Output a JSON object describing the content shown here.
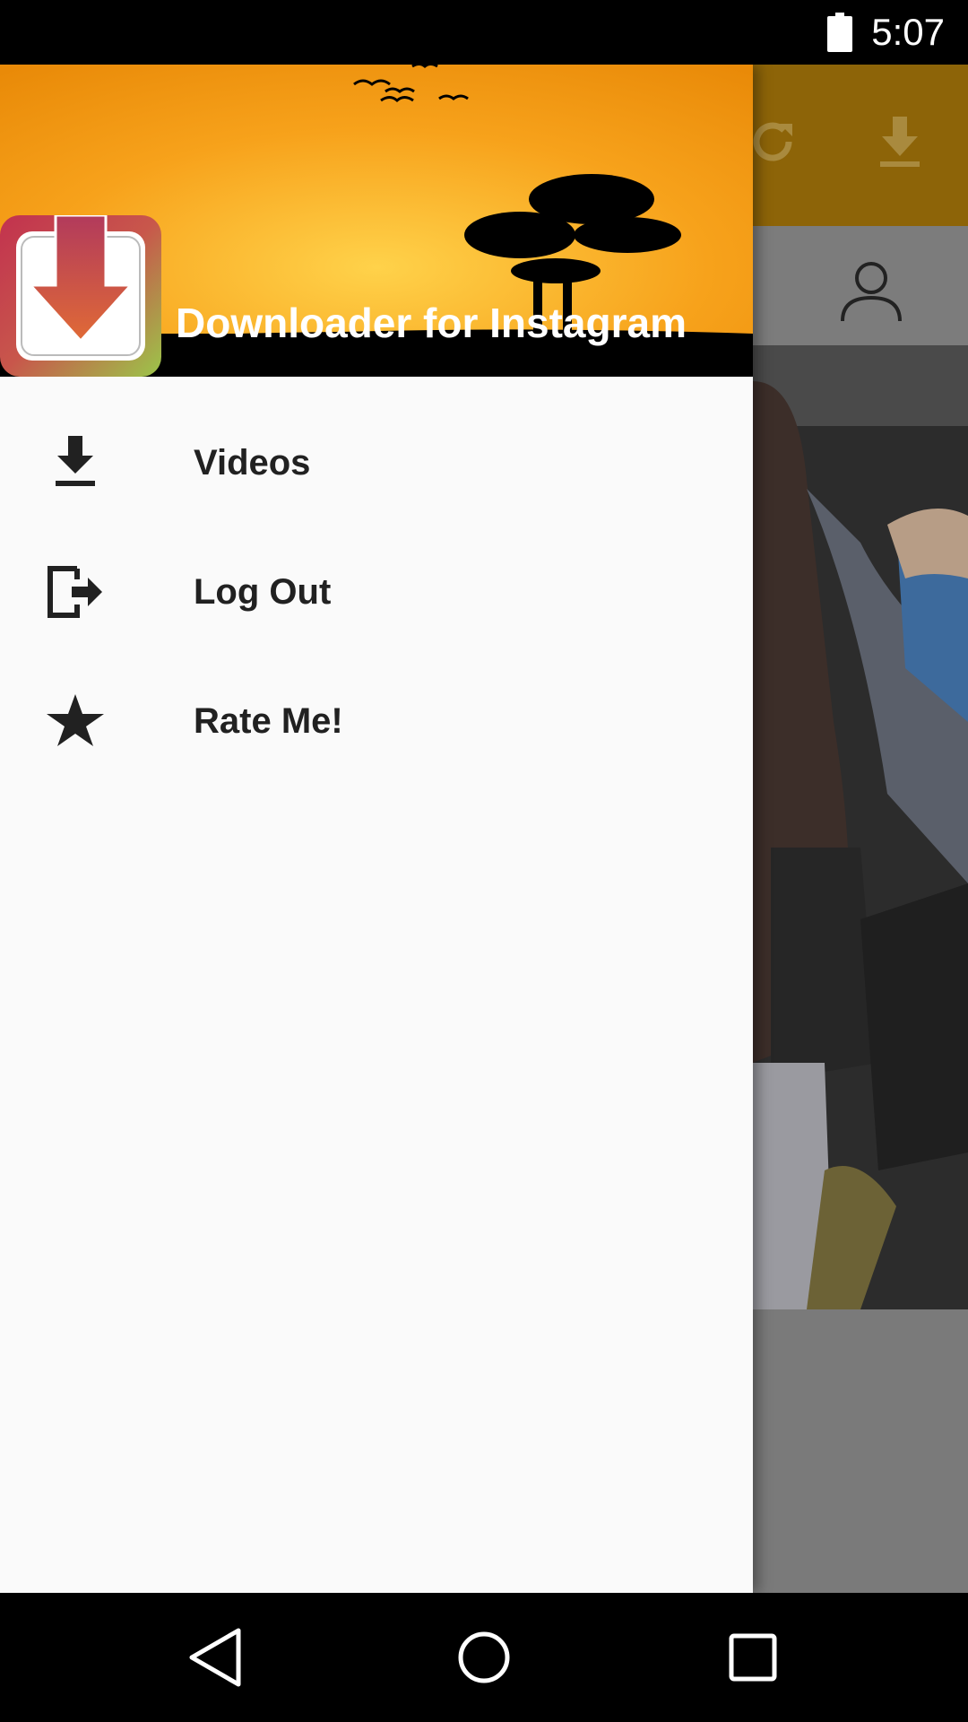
{
  "status_bar": {
    "time": "5:07"
  },
  "drawer": {
    "app_name": "Downloader for Instagram",
    "items": [
      {
        "label": "Videos",
        "icon": "download-icon"
      },
      {
        "label": "Log Out",
        "icon": "logout-icon"
      },
      {
        "label": "Rate Me!",
        "icon": "star-icon"
      }
    ]
  },
  "colors": {
    "toolbar": "#8d6408",
    "drawer_bg": "#fafafa",
    "header_sky": "#f29a12",
    "text": "#212121"
  }
}
